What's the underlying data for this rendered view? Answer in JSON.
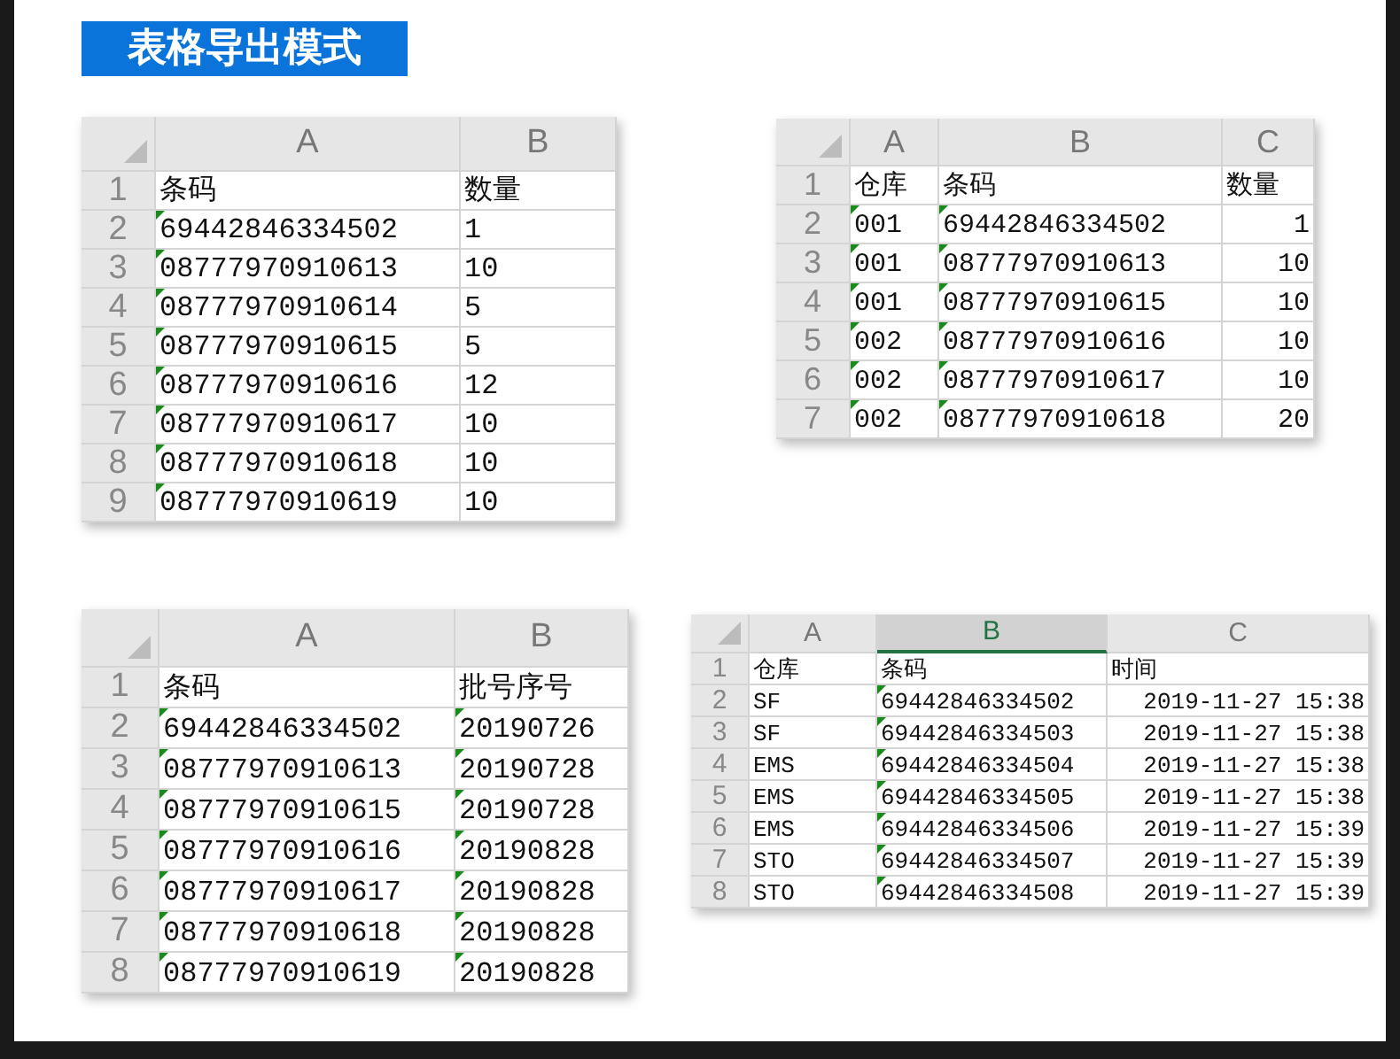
{
  "title": "表格导出模式",
  "sheets": [
    {
      "columns": [
        {
          "letter": "A",
          "right_aligned": false,
          "selected": false
        },
        {
          "letter": "B",
          "right_aligned": false,
          "selected": false
        }
      ],
      "rows": [
        {
          "number": "1",
          "cells": [
            {
              "text": "条码",
              "flagged": false
            },
            {
              "text": "数量",
              "flagged": false
            }
          ]
        },
        {
          "number": "2",
          "cells": [
            {
              "text": "69442846334502",
              "flagged": true
            },
            {
              "text": "1",
              "flagged": false
            }
          ]
        },
        {
          "number": "3",
          "cells": [
            {
              "text": "08777970910613",
              "flagged": true
            },
            {
              "text": "10",
              "flagged": false
            }
          ]
        },
        {
          "number": "4",
          "cells": [
            {
              "text": "08777970910614",
              "flagged": true
            },
            {
              "text": "5",
              "flagged": false
            }
          ]
        },
        {
          "number": "5",
          "cells": [
            {
              "text": "08777970910615",
              "flagged": true
            },
            {
              "text": "5",
              "flagged": false
            }
          ]
        },
        {
          "number": "6",
          "cells": [
            {
              "text": "08777970910616",
              "flagged": true
            },
            {
              "text": "12",
              "flagged": false
            }
          ]
        },
        {
          "number": "7",
          "cells": [
            {
              "text": "08777970910617",
              "flagged": true
            },
            {
              "text": "10",
              "flagged": false
            }
          ]
        },
        {
          "number": "8",
          "cells": [
            {
              "text": "08777970910618",
              "flagged": true
            },
            {
              "text": "10",
              "flagged": false
            }
          ]
        },
        {
          "number": "9",
          "cells": [
            {
              "text": "08777970910619",
              "flagged": true
            },
            {
              "text": "10",
              "flagged": false
            }
          ]
        }
      ]
    },
    {
      "columns": [
        {
          "letter": "A",
          "right_aligned": false,
          "selected": false
        },
        {
          "letter": "B",
          "right_aligned": false,
          "selected": false
        },
        {
          "letter": "C",
          "right_aligned": true,
          "selected": false
        }
      ],
      "rows": [
        {
          "number": "1",
          "cells": [
            {
              "text": "仓库",
              "flagged": false
            },
            {
              "text": "条码",
              "flagged": false
            },
            {
              "text": "数量",
              "flagged": false
            }
          ]
        },
        {
          "number": "2",
          "cells": [
            {
              "text": "001",
              "flagged": true
            },
            {
              "text": "69442846334502",
              "flagged": true
            },
            {
              "text": "1",
              "flagged": false
            }
          ]
        },
        {
          "number": "3",
          "cells": [
            {
              "text": "001",
              "flagged": true
            },
            {
              "text": "08777970910613",
              "flagged": true
            },
            {
              "text": "10",
              "flagged": false
            }
          ]
        },
        {
          "number": "4",
          "cells": [
            {
              "text": "001",
              "flagged": true
            },
            {
              "text": "08777970910615",
              "flagged": true
            },
            {
              "text": "10",
              "flagged": false
            }
          ]
        },
        {
          "number": "5",
          "cells": [
            {
              "text": "002",
              "flagged": true
            },
            {
              "text": "08777970910616",
              "flagged": true
            },
            {
              "text": "10",
              "flagged": false
            }
          ]
        },
        {
          "number": "6",
          "cells": [
            {
              "text": "002",
              "flagged": true
            },
            {
              "text": "08777970910617",
              "flagged": true
            },
            {
              "text": "10",
              "flagged": false
            }
          ]
        },
        {
          "number": "7",
          "cells": [
            {
              "text": "002",
              "flagged": true
            },
            {
              "text": "08777970910618",
              "flagged": true
            },
            {
              "text": "20",
              "flagged": false
            }
          ]
        }
      ]
    },
    {
      "columns": [
        {
          "letter": "A",
          "right_aligned": false,
          "selected": false
        },
        {
          "letter": "B",
          "right_aligned": false,
          "selected": false
        }
      ],
      "rows": [
        {
          "number": "1",
          "cells": [
            {
              "text": "条码",
              "flagged": false
            },
            {
              "text": "批号序号",
              "flagged": false
            }
          ]
        },
        {
          "number": "2",
          "cells": [
            {
              "text": "69442846334502",
              "flagged": true
            },
            {
              "text": "20190726",
              "flagged": true
            }
          ]
        },
        {
          "number": "3",
          "cells": [
            {
              "text": "08777970910613",
              "flagged": true
            },
            {
              "text": "20190728",
              "flagged": true
            }
          ]
        },
        {
          "number": "4",
          "cells": [
            {
              "text": "08777970910615",
              "flagged": true
            },
            {
              "text": "20190728",
              "flagged": true
            }
          ]
        },
        {
          "number": "5",
          "cells": [
            {
              "text": "08777970910616",
              "flagged": true
            },
            {
              "text": "20190828",
              "flagged": true
            }
          ]
        },
        {
          "number": "6",
          "cells": [
            {
              "text": "08777970910617",
              "flagged": true
            },
            {
              "text": "20190828",
              "flagged": true
            }
          ]
        },
        {
          "number": "7",
          "cells": [
            {
              "text": "08777970910618",
              "flagged": true
            },
            {
              "text": "20190828",
              "flagged": true
            }
          ]
        },
        {
          "number": "8",
          "cells": [
            {
              "text": "08777970910619",
              "flagged": true
            },
            {
              "text": "20190828",
              "flagged": true
            }
          ]
        }
      ]
    },
    {
      "columns": [
        {
          "letter": "A",
          "right_aligned": false,
          "selected": false
        },
        {
          "letter": "B",
          "right_aligned": false,
          "selected": true
        },
        {
          "letter": "C",
          "right_aligned": true,
          "selected": false
        }
      ],
      "rows": [
        {
          "number": "1",
          "cells": [
            {
              "text": "仓库",
              "flagged": false
            },
            {
              "text": "条码",
              "flagged": false
            },
            {
              "text": "时间",
              "flagged": false
            }
          ]
        },
        {
          "number": "2",
          "cells": [
            {
              "text": "SF",
              "flagged": false
            },
            {
              "text": "69442846334502",
              "flagged": true
            },
            {
              "text": "2019-11-27 15:38",
              "flagged": false
            }
          ]
        },
        {
          "number": "3",
          "cells": [
            {
              "text": "SF",
              "flagged": false
            },
            {
              "text": "69442846334503",
              "flagged": true
            },
            {
              "text": "2019-11-27 15:38",
              "flagged": false
            }
          ]
        },
        {
          "number": "4",
          "cells": [
            {
              "text": "EMS",
              "flagged": false
            },
            {
              "text": "69442846334504",
              "flagged": true
            },
            {
              "text": "2019-11-27 15:38",
              "flagged": false
            }
          ]
        },
        {
          "number": "5",
          "cells": [
            {
              "text": "EMS",
              "flagged": false
            },
            {
              "text": "69442846334505",
              "flagged": true
            },
            {
              "text": "2019-11-27 15:38",
              "flagged": false
            }
          ]
        },
        {
          "number": "6",
          "cells": [
            {
              "text": "EMS",
              "flagged": false
            },
            {
              "text": "69442846334506",
              "flagged": true
            },
            {
              "text": "2019-11-27 15:39",
              "flagged": false
            }
          ]
        },
        {
          "number": "7",
          "cells": [
            {
              "text": "STO",
              "flagged": false
            },
            {
              "text": "69442846334507",
              "flagged": true
            },
            {
              "text": "2019-11-27 15:39",
              "flagged": false
            }
          ]
        },
        {
          "number": "8",
          "cells": [
            {
              "text": "STO",
              "flagged": false
            },
            {
              "text": "69442846334508",
              "flagged": true
            },
            {
              "text": "2019-11-27 15:39",
              "flagged": false
            }
          ]
        }
      ]
    }
  ]
}
